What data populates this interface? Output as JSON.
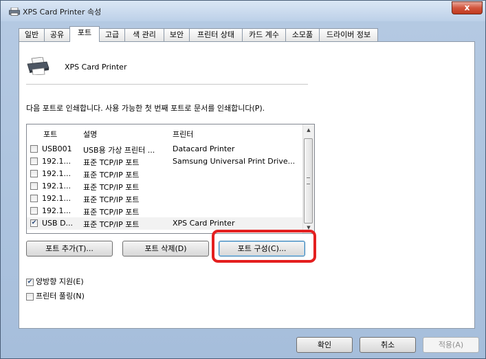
{
  "window": {
    "title": "XPS Card Printer 속성",
    "close_symbol": "x",
    "printer_icon": "printer-icon"
  },
  "tabs": [
    {
      "label": "일반"
    },
    {
      "label": "공유"
    },
    {
      "label": "포트"
    },
    {
      "label": "고급"
    },
    {
      "label": "색 관리"
    },
    {
      "label": "보안"
    },
    {
      "label": "프린터 상태"
    },
    {
      "label": "카드 계수"
    },
    {
      "label": "소모품"
    },
    {
      "label": "드라이버 정보"
    }
  ],
  "panel": {
    "printer_name": "XPS Card Printer",
    "description": "다음 포트로 인쇄합니다. 사용 가능한 첫 번째 포트로 문서를 인쇄합니다(P).",
    "columns": [
      "포트",
      "설명",
      "프린터"
    ],
    "rows": [
      {
        "checked": false,
        "port": "USB001",
        "desc": "USB용 가상 프린터 ...",
        "printer": "Datacard Printer"
      },
      {
        "checked": false,
        "port": "192.1...",
        "desc": "표준 TCP/IP 포트",
        "printer": "Samsung Universal Print Drive..."
      },
      {
        "checked": false,
        "port": "192.1...",
        "desc": "표준 TCP/IP 포트",
        "printer": ""
      },
      {
        "checked": false,
        "port": "192.1...",
        "desc": "표준 TCP/IP 포트",
        "printer": ""
      },
      {
        "checked": false,
        "port": "192.1...",
        "desc": "표준 TCP/IP 포트",
        "printer": ""
      },
      {
        "checked": false,
        "port": "192.1...",
        "desc": "표준 TCP/IP 포트",
        "printer": ""
      },
      {
        "checked": true,
        "port": "USB D...",
        "desc": "표준 TCP/IP 포트",
        "printer": "XPS Card Printer"
      }
    ],
    "add_port": "포트 추가(T)...",
    "delete_port": "포트 삭제(D)",
    "configure_port": "포트 구성(C)...",
    "bidirectional": {
      "label": "양방향 지원(E)",
      "checked": true
    },
    "pooling": {
      "label": "프린터 풀링(N)",
      "checked": false
    }
  },
  "footer": {
    "ok": "확인",
    "cancel": "취소",
    "apply": "적용(A)"
  },
  "colors": {
    "highlight": "#e41f1f",
    "close": "#c03a1f"
  }
}
